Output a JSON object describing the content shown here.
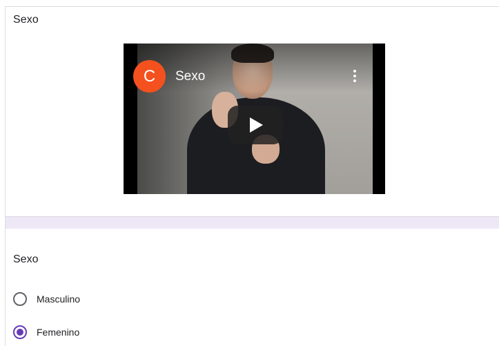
{
  "video_card": {
    "title": "Sexo",
    "video": {
      "channel_initial": "C",
      "title": "Sexo",
      "channel_color": "#f4511e"
    }
  },
  "question": {
    "title": "Sexo",
    "options": [
      {
        "label": "Masculino",
        "selected": false
      },
      {
        "label": "Femenino",
        "selected": true
      }
    ],
    "accent_color": "#673ab7"
  }
}
